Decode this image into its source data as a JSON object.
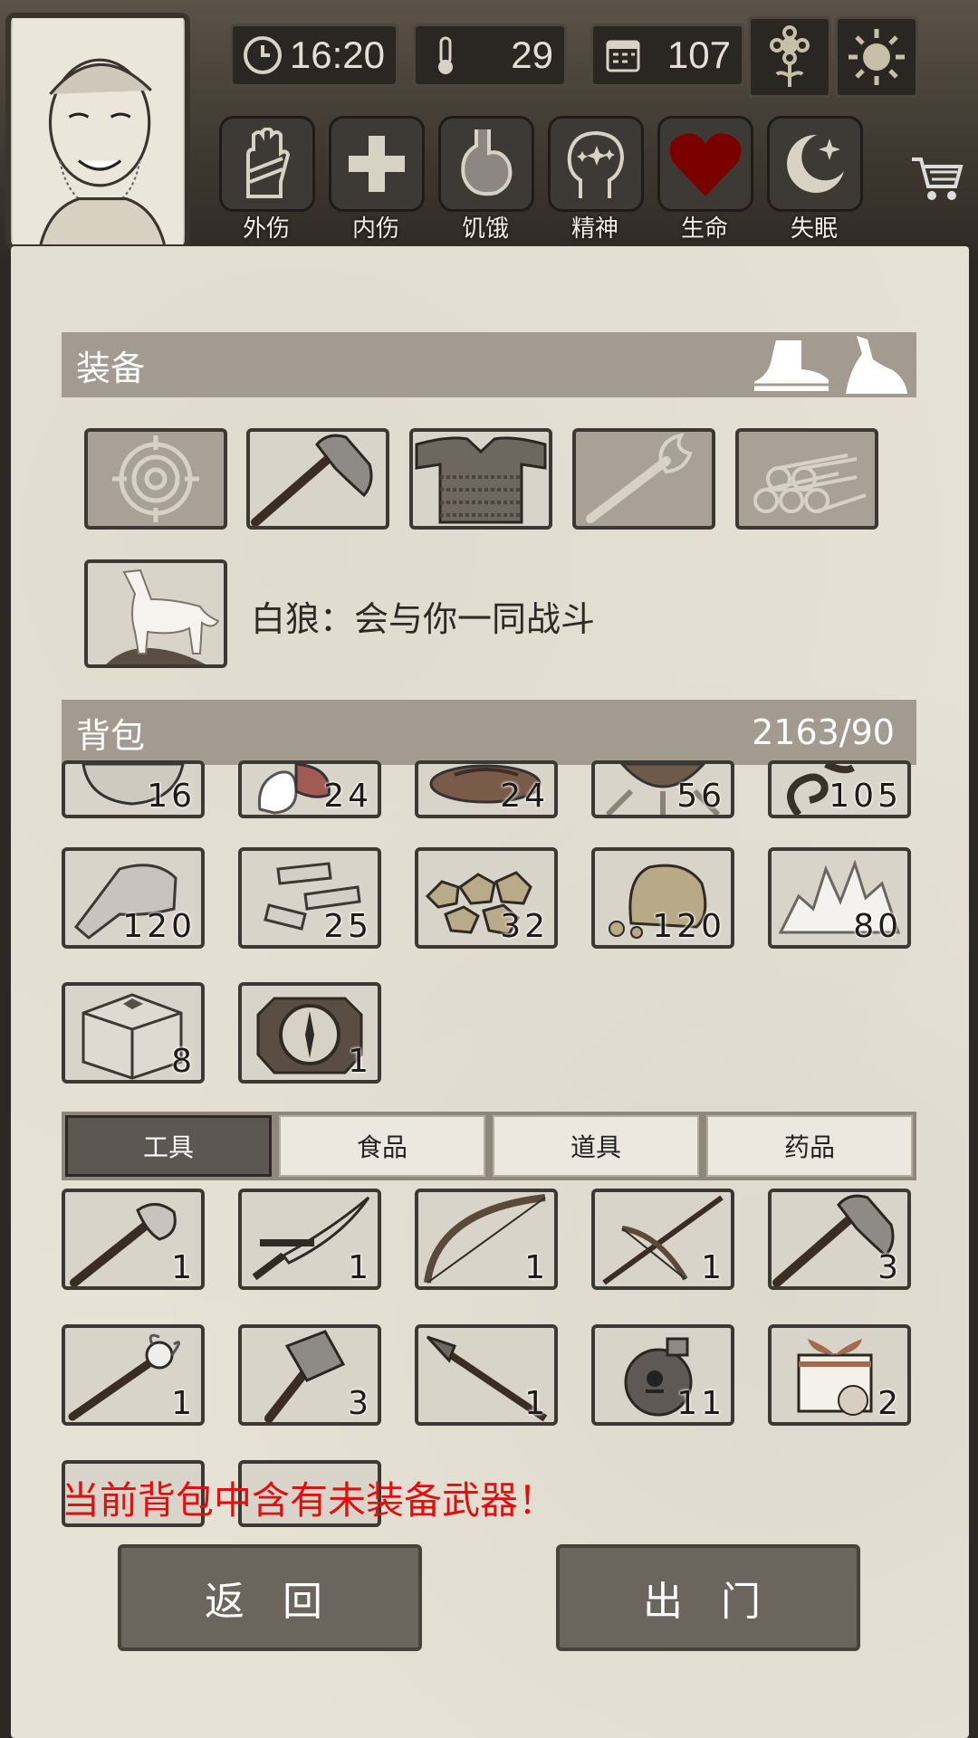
{
  "stats": {
    "time": "16:20",
    "temperature": "29",
    "day": "107"
  },
  "status_bar": [
    {
      "label": "外伤",
      "icon": "hand-bandage-icon"
    },
    {
      "label": "内伤",
      "icon": "cross-icon"
    },
    {
      "label": "饥饿",
      "icon": "stomach-icon"
    },
    {
      "label": "精神",
      "icon": "head-sparkle-icon"
    },
    {
      "label": "生命",
      "icon": "heart-icon"
    },
    {
      "label": "失眠",
      "icon": "moon-star-icon"
    }
  ],
  "equipment": {
    "title": "装备",
    "slots": [
      {
        "name": "target-slot",
        "icon": "target-icon",
        "empty": true
      },
      {
        "name": "axe-slot",
        "icon": "axe-icon",
        "empty": false
      },
      {
        "name": "armor-slot",
        "icon": "chainmail-icon",
        "empty": false
      },
      {
        "name": "torch-slot",
        "icon": "torch-icon",
        "empty": true
      },
      {
        "name": "firewood-slot",
        "icon": "logs-icon",
        "empty": true
      }
    ],
    "companion_text": "白狼：会与你一同战斗"
  },
  "backpack": {
    "title": "背包",
    "capacity": "2163/90",
    "items": [
      {
        "icon": "bowl-icon",
        "count": "16"
      },
      {
        "icon": "meat-icon",
        "count": "24"
      },
      {
        "icon": "grill-icon",
        "count": "24"
      },
      {
        "icon": "basket-icon",
        "count": "56"
      },
      {
        "icon": "rope-icon",
        "count": "105"
      },
      {
        "icon": "stone-icon",
        "count": "120"
      },
      {
        "icon": "planks-icon",
        "count": "25"
      },
      {
        "icon": "ore-icon",
        "count": "32"
      },
      {
        "icon": "rock-icon",
        "count": "120"
      },
      {
        "icon": "crystal-icon",
        "count": "80"
      },
      {
        "icon": "crate-icon",
        "count": "8"
      },
      {
        "icon": "compass-icon",
        "count": "1"
      }
    ]
  },
  "tabs": [
    "工具",
    "食品",
    "道具",
    "药品"
  ],
  "tools": [
    {
      "icon": "stone-axe-icon",
      "count": "1"
    },
    {
      "icon": "katana-icon",
      "count": "1"
    },
    {
      "icon": "bow-icon",
      "count": "1"
    },
    {
      "icon": "crossbow-icon",
      "count": "1"
    },
    {
      "icon": "axe-icon",
      "count": "3"
    },
    {
      "icon": "magic-staff-icon",
      "count": "1"
    },
    {
      "icon": "hammer-icon",
      "count": "3"
    },
    {
      "icon": "spear-icon",
      "count": "1"
    },
    {
      "icon": "bomb-jar-icon",
      "count": "11"
    },
    {
      "icon": "gift-box-icon",
      "count": "2"
    }
  ],
  "warning": "当前背包中含有未装备武器！",
  "buttons": {
    "back": "返 回",
    "go_out": "出 门"
  },
  "colors": {
    "warning": "#e01010",
    "health": "#7a0000"
  }
}
